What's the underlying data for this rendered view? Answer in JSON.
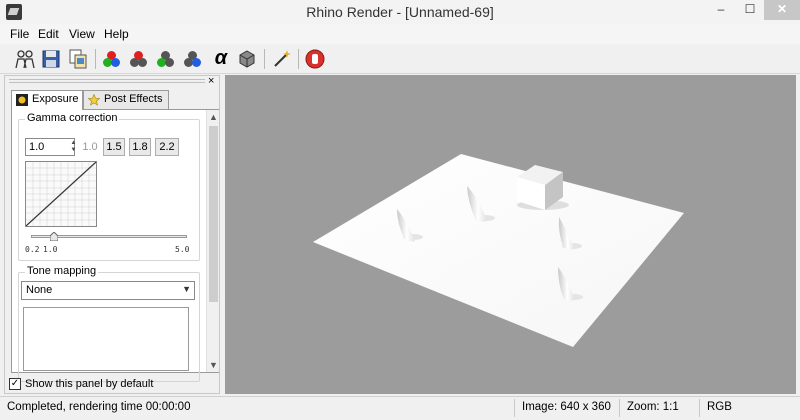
{
  "window": {
    "title": "Rhino Render - [Unnamed-69]",
    "min": "–",
    "max": "☐",
    "close": "✕"
  },
  "menu": {
    "items": [
      "File",
      "Edit",
      "View",
      "Help"
    ]
  },
  "toolbar": {
    "icons": [
      "copy-people-icon",
      "save-icon",
      "copy-image-icon",
      "rgb-channels-icon",
      "red-channel-icon",
      "green-channel-icon",
      "blue-channel-icon",
      "alpha-channel-icon",
      "monochrome-icon",
      "post-effect-wand-icon",
      "stop-render-icon"
    ],
    "alpha_glyph": "α"
  },
  "panel": {
    "close_glyph": "×",
    "tabs": [
      "Exposure",
      "Post Effects"
    ],
    "gamma": {
      "label": "Gamma correction",
      "value": "1.0",
      "presets": [
        "1.0",
        "1.5",
        "1.8",
        "2.2"
      ],
      "slider": {
        "min": 0.2,
        "max": 5.0,
        "current": 1.0,
        "labels": [
          "0.2",
          "1.0",
          "5.0"
        ]
      }
    },
    "tone": {
      "label": "Tone mapping",
      "selected": "None"
    },
    "show_by_default": {
      "label": "Show this panel by default",
      "checked": true
    }
  },
  "status": {
    "message": "Completed, rendering time 00:00:00",
    "image": "Image: 640 x 360",
    "zoom": "Zoom: 1:1",
    "mode": "RGB"
  },
  "colors": {
    "viewport_bg": "#9c9c9c",
    "stop": "#d9312b"
  }
}
